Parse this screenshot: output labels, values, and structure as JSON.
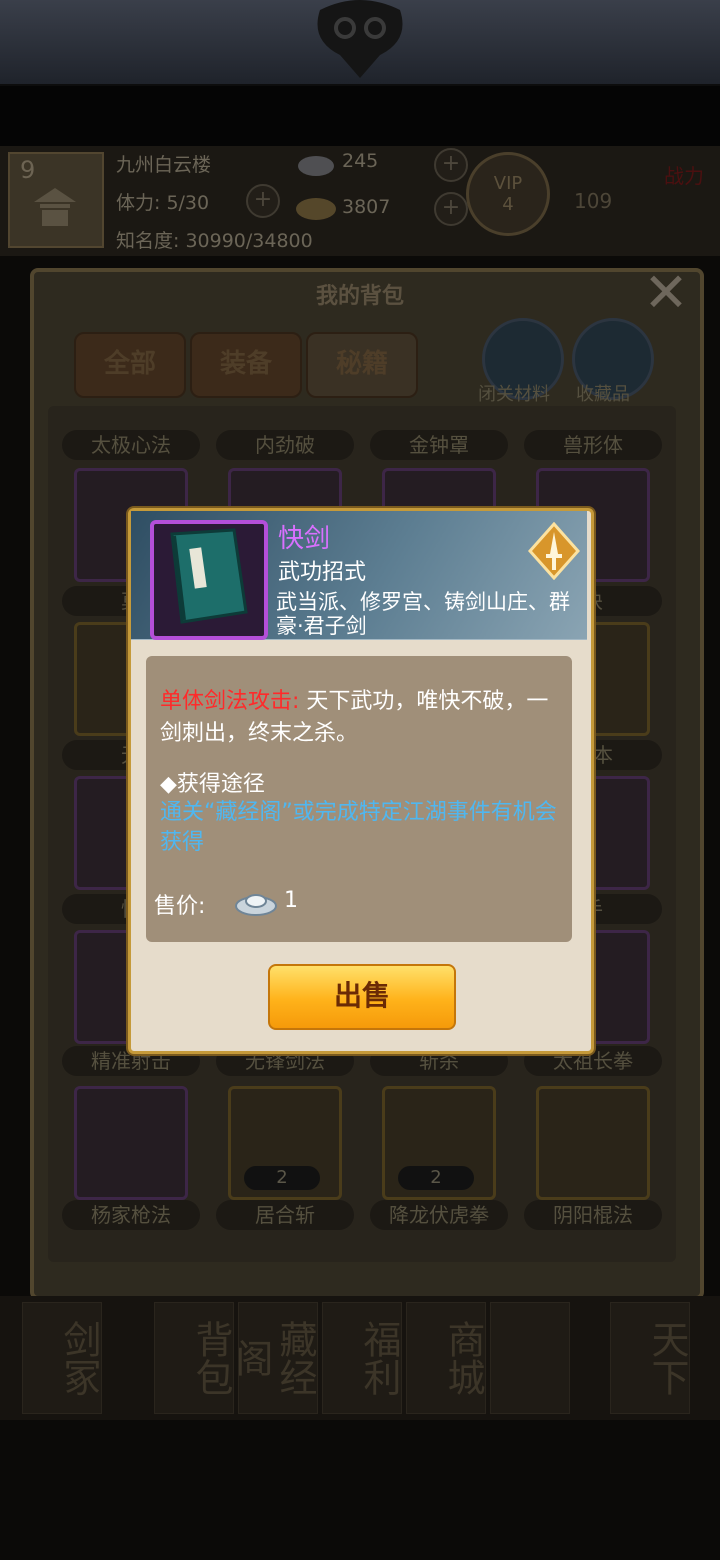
{
  "player": {
    "level": "9",
    "name": "九州白云楼",
    "stamina": "体力: 5/30",
    "fame": "知名度: 30990/34800",
    "silver": "245",
    "gold": "3807",
    "vip": "VIP",
    "vip_level": "4",
    "power_label": "战力",
    "power_value": "109"
  },
  "bag": {
    "title": "我的背包",
    "tabs": [
      "全部",
      "装备",
      "秘籍"
    ],
    "side_buttons": [
      "闭关材料",
      "收藏品"
    ],
    "rows": [
      [
        "太极心法",
        "内劲破",
        "金钟罩",
        "兽形体"
      ],
      [
        "",
        "",
        "",
        ""
      ],
      [
        "",
        "",
        "",
        ""
      ],
      [
        "精准射击",
        "无锋剑法",
        "斩杀",
        "太祖长拳"
      ],
      [
        "杨家枪法",
        "居合斩",
        "降龙伏虎拳",
        "阴阳棍法"
      ]
    ],
    "partial_names": {
      "r2c1": "莫",
      "r2c4": "诀",
      "r3c1": "无",
      "r3c4": "残本",
      "r4c1": "快",
      "r4c4": "手"
    },
    "counts": {
      "juhe": "2",
      "xianglong": "2"
    }
  },
  "nav": {
    "items": [
      "剑冢",
      "背包",
      "藏经阁",
      "福利",
      "商城",
      "",
      "天下"
    ]
  },
  "popup": {
    "name": "快剑",
    "type": "武功招式",
    "schools": "武当派、修罗宫、铸剑山庄、群豪·君子剑",
    "effect_label": "单体剑法攻击:",
    "effect_text": "天下武功，唯快不破，一剑刺出，终末之杀。",
    "way_title": "◆获得途径",
    "way_text": "通关“藏经阁”或完成特定江湖事件有机会获得",
    "price_label": "售价:",
    "price_value": "1",
    "sell_button": "出售"
  }
}
